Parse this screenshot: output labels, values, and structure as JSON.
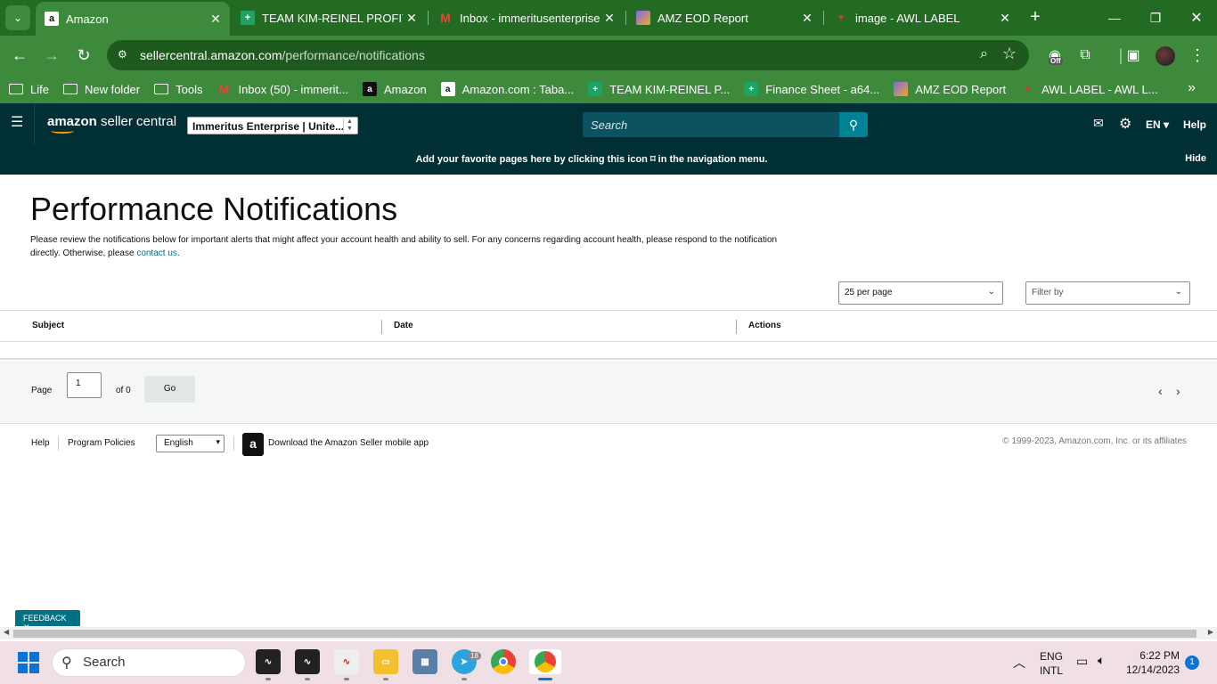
{
  "browser": {
    "tabs": [
      {
        "title": "Amazon",
        "active": true,
        "icon": "amazon-icon"
      },
      {
        "title": "TEAM KIM-REINEL PROFIT SH",
        "active": false,
        "icon": "sheets-icon"
      },
      {
        "title": "Inbox - immeritusenterprises",
        "active": false,
        "icon": "gmail-icon"
      },
      {
        "title": "AMZ EOD Report",
        "active": false,
        "icon": "clickup-icon"
      },
      {
        "title": "image - AWL LABEL",
        "active": false,
        "icon": "awl-icon"
      }
    ],
    "url_host": "sellercentral.amazon.com",
    "url_path": "/performance/notifications",
    "extension_badge": "Off",
    "bookmarks": [
      {
        "label": "Life",
        "icon": "folder-icon"
      },
      {
        "label": "New folder",
        "icon": "folder-icon"
      },
      {
        "label": "Tools",
        "icon": "folder-icon"
      },
      {
        "label": "Inbox (50) - immerit...",
        "icon": "gmail-icon"
      },
      {
        "label": "Amazon",
        "icon": "amazon-icon"
      },
      {
        "label": "Amazon.com : Taba...",
        "icon": "amazon-icon"
      },
      {
        "label": "TEAM KIM-REINEL P...",
        "icon": "sheets-icon"
      },
      {
        "label": "Finance Sheet - a64...",
        "icon": "sheets-icon"
      },
      {
        "label": "AMZ EOD Report",
        "icon": "clickup-icon"
      },
      {
        "label": "AWL LABEL - AWL L...",
        "icon": "awl-icon"
      }
    ]
  },
  "header": {
    "logo_text_bold": "amazon",
    "logo_text": "seller central",
    "account": "Immeritus Enterprise | Unite...",
    "search_placeholder": "Search",
    "language": "EN",
    "help": "Help"
  },
  "banner": {
    "message_before": "Add your favorite pages here by clicking this icon",
    "message_after": "in the navigation menu.",
    "hide": "Hide"
  },
  "page": {
    "title": "Performance Notifications",
    "description": "Please review the notifications below for important alerts that might affect your account health and ability to sell. For any concerns regarding account health, please respond to the notification directly. Otherwise, please",
    "contact_link": "contact us",
    "per_page": "25 per page",
    "filter_placeholder": "Filter by",
    "columns": [
      "Subject",
      "Date",
      "Actions"
    ],
    "rows": []
  },
  "pager": {
    "page_label": "Page",
    "page_value": "1",
    "of_label": "of 0",
    "go_label": "Go"
  },
  "footer": {
    "help": "Help",
    "policies": "Program Policies",
    "language": "English",
    "app_text": "Download the Amazon Seller mobile app",
    "copyright": "© 1999-2023, Amazon.com, Inc. or its affiliates"
  },
  "feedback": "FEEDBACK",
  "taskbar": {
    "search": "Search",
    "telegram_badge": "18",
    "lang_top": "ENG",
    "lang_bottom": "INTL",
    "time": "6:22 PM",
    "date": "12/14/2023",
    "notifications": "1"
  }
}
